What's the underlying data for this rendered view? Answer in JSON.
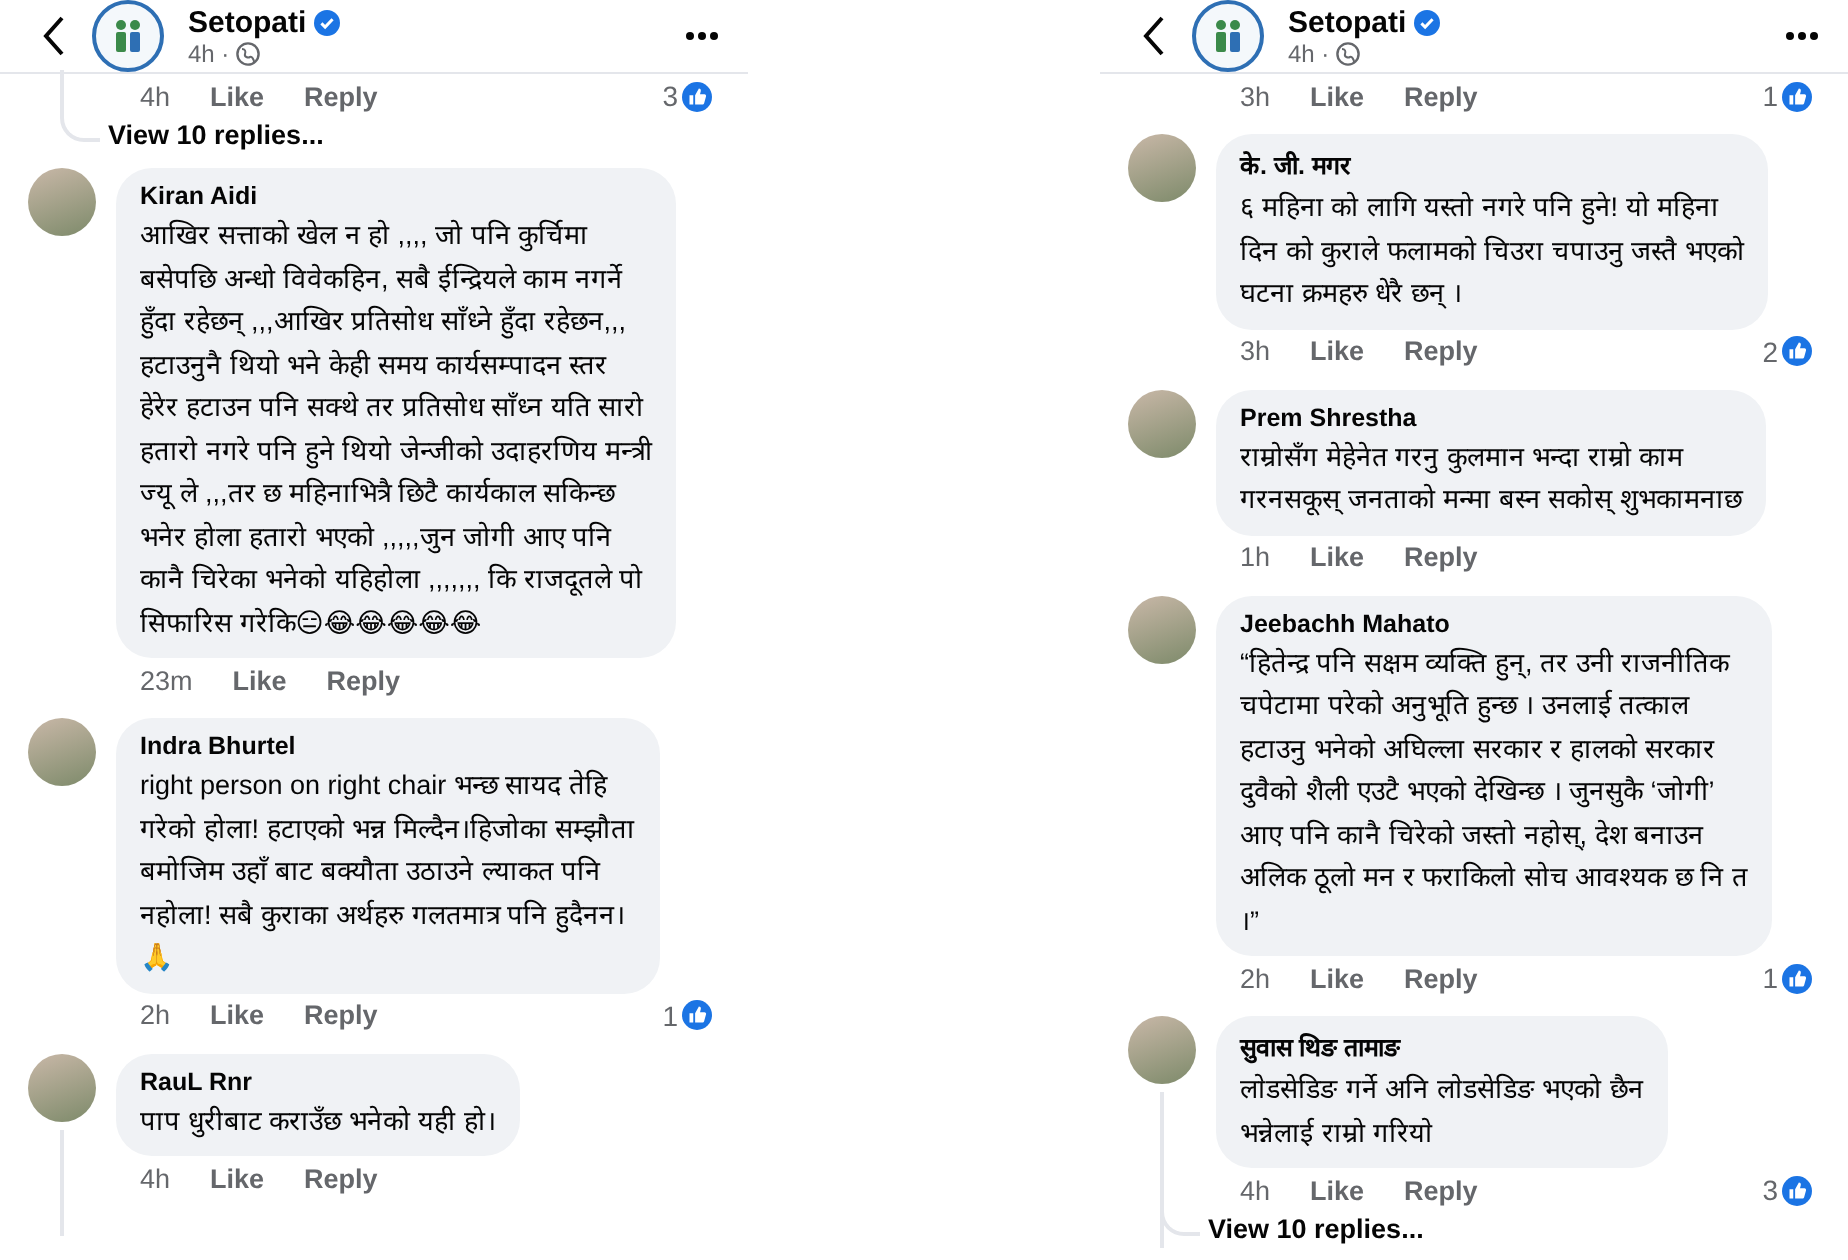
{
  "panels": [
    {
      "header": {
        "name": "Setopati",
        "time": "4h ·"
      },
      "items": [
        {
          "kind": "actions",
          "time": "4h",
          "like": "Like",
          "reply": "Reply",
          "reactions": "3"
        },
        {
          "kind": "view_replies",
          "text": "View 10 replies..."
        },
        {
          "kind": "comment",
          "name": "Kiran Aidi",
          "lines": [
            "आखिर सत्ताको खेल न हो ,,,, जो पनि कुर्चिमा",
            "बसेपछि अन्धो विवेकहिन, सबै ईन्द्रियले काम नगर्ने",
            "हुँदा रहेछन् ,,,आखिर प्रतिसोध साँध्ने हुँदा रहेछन,,,",
            "हटाउनुनै थियो भने केही समय कार्यसम्पादन स्तर",
            "हेरेर हटाउन पनि सक्थे तर प्रतिसोध साँध्न यति सारो",
            "हतारो नगरे पनि हुने थियो जेन्जीको उदाहरणिय मन्त्री",
            "ज्यू ले ,,,तर छ महिनाभित्रै छिटै कार्यकाल सकिन्छ",
            "भनेर होला हतारो भएको ,,,,,जुन जोगी आए पनि",
            "कानै चिरेका भनेको यहिहोला ,,,,,,, कि राजदूतले पो",
            "सिफारिस गरेकि😑😂😂😂😂😂"
          ],
          "thread": false
        },
        {
          "kind": "actions",
          "time": "23m",
          "like": "Like",
          "reply": "Reply"
        },
        {
          "kind": "comment",
          "name": "Indra Bhurtel",
          "lines": [
            "right person on right chair भन्छ सायद तेहि",
            "गरेको होला! हटाएको भन्न मिल्दैन।हिजोका सम्झौता",
            "बमोजिम उहाँ बाट बक्यौता उठाउने ल्याकत पनि",
            "नहोला! सबै कुराका अर्थहरु गलतमात्र पनि हुदैनन।",
            "🙏"
          ],
          "thread": false
        },
        {
          "kind": "actions",
          "time": "2h",
          "like": "Like",
          "reply": "Reply",
          "reactions": "1"
        },
        {
          "kind": "comment",
          "name": "RauL Rnr",
          "lines": [
            "पाप धुरीबाट कराउँछ भनेको यही हो।"
          ],
          "thread": true
        },
        {
          "kind": "actions",
          "time": "4h",
          "like": "Like",
          "reply": "Reply"
        }
      ]
    },
    {
      "header": {
        "name": "Setopati",
        "time": "4h ·"
      },
      "items": [
        {
          "kind": "actions",
          "time": "3h",
          "like": "Like",
          "reply": "Reply",
          "reactions": "1"
        },
        {
          "kind": "comment",
          "name": "के. जी. मगर",
          "lines": [
            "६ महिना को लागि यस्तो नगरे पनि हुने! यो महिना",
            "दिन को कुराले फलामको चिउरा चपाउनु जस्तै भएको",
            "घटना क्रमहरु धेरै छन् ।"
          ],
          "thread": false
        },
        {
          "kind": "actions",
          "time": "3h",
          "like": "Like",
          "reply": "Reply",
          "reactions": "2"
        },
        {
          "kind": "comment",
          "name": "Prem Shrestha",
          "lines": [
            "राम्रोसँग मेहेनेत गरनु कुलमान भन्दा राम्रो काम",
            "गरनसकूस् जनताको मन्मा बस्न सकोस् शुभकामनाछ"
          ],
          "thread": false
        },
        {
          "kind": "actions",
          "time": "1h",
          "like": "Like",
          "reply": "Reply"
        },
        {
          "kind": "comment",
          "name": "Jeebachh Mahato",
          "lines": [
            "“हितेन्द्र पनि सक्षम व्यक्ति हुन्, तर उनी राजनीतिक",
            "चपेटामा परेको अनुभूति हुन्छ । उनलाई तत्काल",
            "हटाउनु भनेको अघिल्ला सरकार र हालको सरकार",
            "दुवैको शैली एउटै भएको देखिन्छ । जुनसुकै ‘जोगी’",
            "आए पनि कानै चिरेको जस्तो नहोस्, देश बनाउन",
            "अलिक ठूलो मन र फराकिलो सोच आवश्यक छ नि त",
            "।”"
          ],
          "thread": false
        },
        {
          "kind": "actions",
          "time": "2h",
          "like": "Like",
          "reply": "Reply",
          "reactions": "1"
        },
        {
          "kind": "comment",
          "name": "सुवास थिङ तामाङ",
          "lines": [
            "लाेडसेडिङ गर्ने अनि लाेडसेडिङ भएको छैन",
            "भन्नेलाई राम्रो गरियाे"
          ],
          "thread": true
        },
        {
          "kind": "actions",
          "time": "4h",
          "like": "Like",
          "reply": "Reply",
          "reactions": "3"
        },
        {
          "kind": "view_replies",
          "text": "View 10 replies..."
        }
      ]
    }
  ]
}
